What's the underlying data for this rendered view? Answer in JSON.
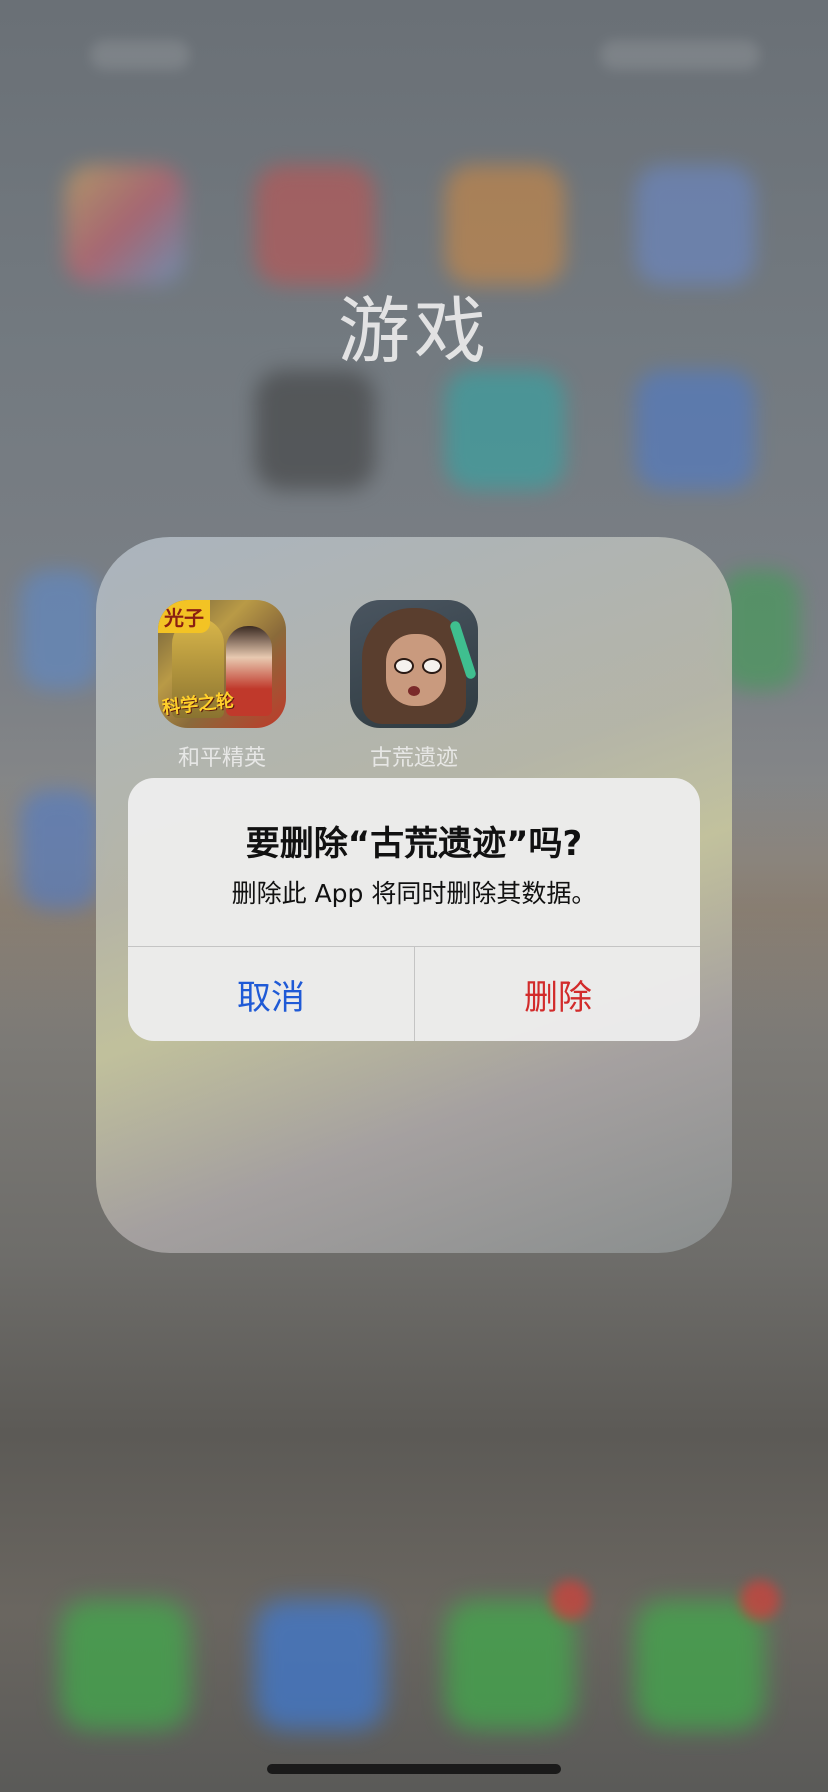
{
  "folder": {
    "title": "游戏",
    "apps": [
      {
        "label": "和平精英",
        "icon": "pubg-game-icon",
        "icon_tag": "光子",
        "icon_banner": "科学之轮"
      },
      {
        "label": "古荒遗迹",
        "icon": "relic-game-icon"
      }
    ]
  },
  "alert": {
    "title": "要删除“古荒遗迹”吗?",
    "message": "删除此 App 将同时删除其数据。",
    "cancel_label": "取消",
    "delete_label": "删除",
    "colors": {
      "cancel": "#1f5ad6",
      "delete": "#d22b2b"
    }
  }
}
